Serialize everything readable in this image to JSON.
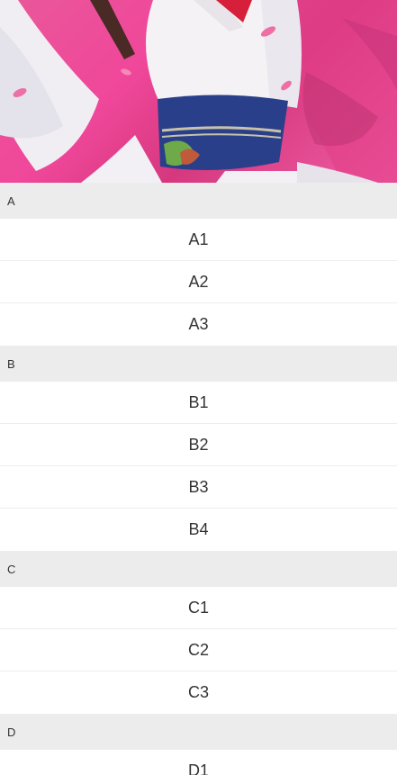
{
  "banner": {
    "icon": "anime-illustration-image"
  },
  "sections": [
    {
      "header": "A",
      "items": [
        "A1",
        "A2",
        "A3"
      ]
    },
    {
      "header": "B",
      "items": [
        "B1",
        "B2",
        "B3",
        "B4"
      ]
    },
    {
      "header": "C",
      "items": [
        "C1",
        "C2",
        "C3"
      ]
    },
    {
      "header": "D",
      "items": [
        "D1"
      ]
    }
  ],
  "colors": {
    "section_bg": "#ececec",
    "row_bg": "#ffffff",
    "text": "#333333",
    "banner_pink": "#ef4d9c"
  }
}
